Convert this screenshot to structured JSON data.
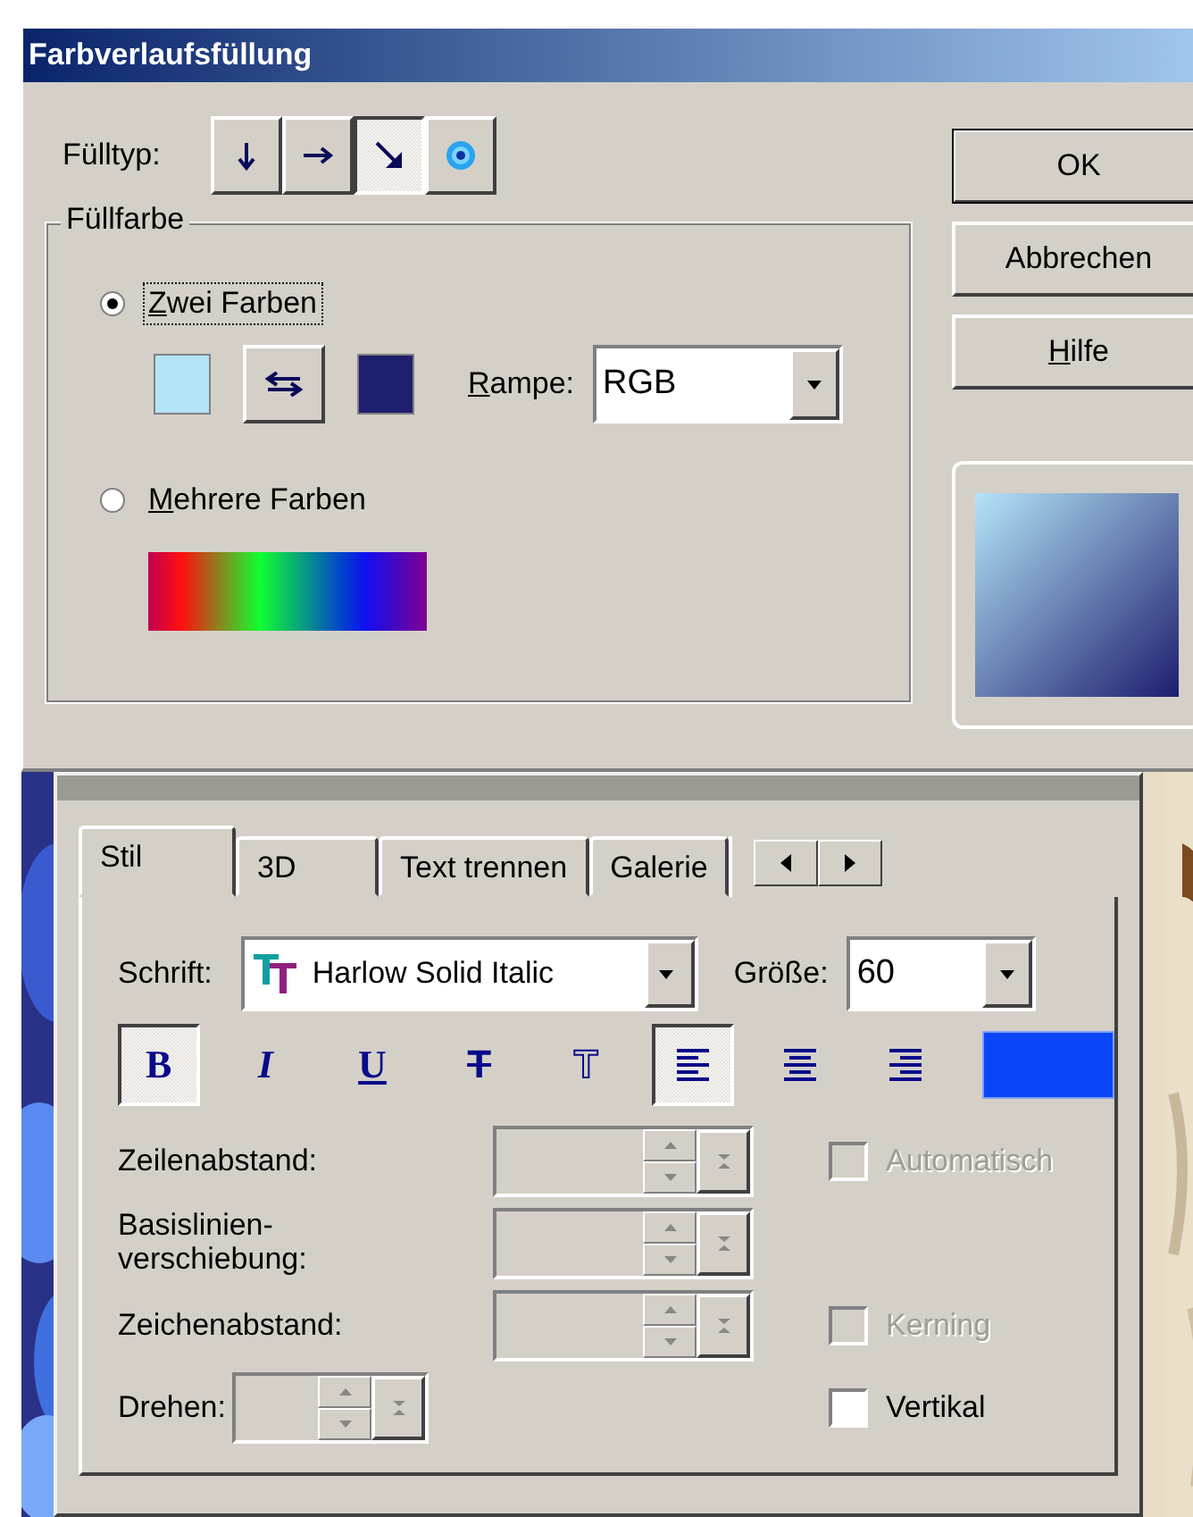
{
  "dialog": {
    "title": "Farbverlaufsfüllung",
    "fill_type": {
      "label": "Fülltyp:",
      "options": [
        {
          "kind": "down",
          "selected": false
        },
        {
          "kind": "right",
          "selected": false
        },
        {
          "kind": "diagonal",
          "selected": true
        },
        {
          "kind": "radial",
          "selected": false
        }
      ]
    },
    "fill_color": {
      "title": "Füllfarbe",
      "two_colors": {
        "label": "Zwei Farben",
        "first_letter_underlined": true,
        "selected": true,
        "focused": true
      },
      "swatches": [
        {
          "color": "#b4e4f8"
        },
        {
          "color": "#1e1e6e"
        }
      ],
      "ramp": {
        "label": "Rampe:",
        "first_letter_underlined": true,
        "value": "RGB"
      },
      "multi_colors": {
        "label": "Mehrere Farben",
        "first_letter_underlined": true,
        "selected": false
      }
    },
    "buttons": [
      {
        "label": "OK",
        "default": true
      },
      {
        "label": "Abbrechen",
        "default": false
      },
      {
        "label": "Hilfe",
        "first_letter_underlined": true,
        "default": false
      }
    ]
  },
  "text_palette": {
    "tabs": [
      {
        "label": "Stil",
        "selected": true
      },
      {
        "label": "3D",
        "selected": false
      },
      {
        "label": "Text trennen",
        "selected": false
      },
      {
        "label": "Galerie",
        "selected": false
      }
    ],
    "font": {
      "label": "Schrift:",
      "value": "Harlow Solid Italic"
    },
    "size": {
      "label": "Größe:",
      "value": "60"
    },
    "styles": [
      {
        "kind": "bold",
        "glyph": "B",
        "selected": true
      },
      {
        "kind": "italic",
        "glyph": "I",
        "selected": false
      },
      {
        "kind": "underline",
        "glyph": "U",
        "selected": false
      },
      {
        "kind": "strike",
        "glyph": "T",
        "selected": false
      },
      {
        "kind": "outline",
        "glyph": "T",
        "selected": false
      }
    ],
    "alignments": [
      {
        "kind": "left",
        "selected": true
      },
      {
        "kind": "center",
        "selected": false
      },
      {
        "kind": "right",
        "selected": false
      }
    ],
    "text_color": {
      "color": "#0a46f8"
    },
    "spin_rows": [
      {
        "label": "Zeilenabstand:",
        "disabled": true,
        "checkbox": {
          "label": "Automatisch",
          "checked": false,
          "disabled": true
        }
      },
      {
        "label": "Basislinien-verschiebung:",
        "disabled": true
      },
      {
        "label": "Zeichenabstand:",
        "disabled": true,
        "checkbox": {
          "label": "Kerning",
          "checked": false,
          "disabled": true
        }
      }
    ],
    "rotate": {
      "label": "Drehen:",
      "disabled": true
    },
    "vertical": {
      "label": "Vertikal",
      "checked": false
    }
  }
}
